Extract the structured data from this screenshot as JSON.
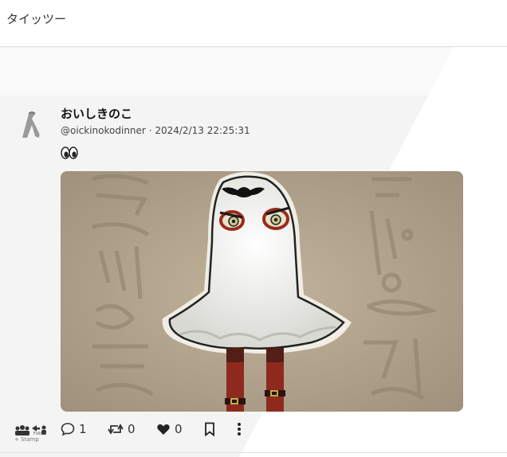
{
  "header": {
    "title": "タイッツー"
  },
  "post": {
    "author_name": "おいしきのこ",
    "handle": "@oickinokodinner",
    "separator": "·",
    "timestamp": "2024/2/13 22:25:31",
    "body_emoji": "eyes",
    "image_alt": "ghost-costume-illustration"
  },
  "actions": {
    "stamp_label": "+ Stamp",
    "follow_label": "Follow",
    "reply_count": "1",
    "retweet_count": "0",
    "like_count": "0"
  },
  "colors": {
    "header_bg": "#ffffff",
    "page_bg": "#f3f3f3",
    "stone_bg": "#b5a690",
    "ghost": "#f2f2ef",
    "accent_red": "#a52a1e"
  }
}
